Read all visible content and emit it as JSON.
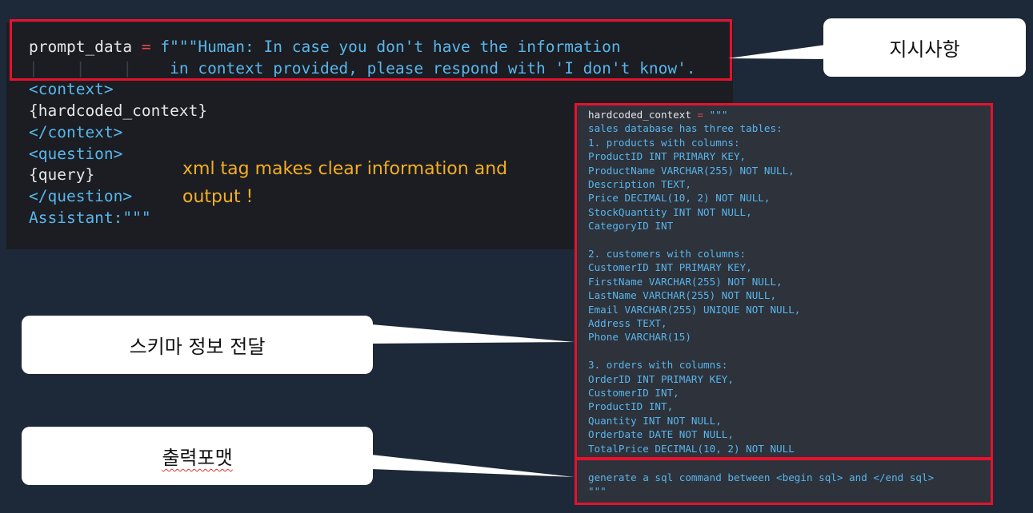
{
  "prompt_code": {
    "line1_var": "prompt_data",
    "line1_op": " = ",
    "line1_str": "f\"\"\"Human: In case you don't have the information",
    "line2_str": "in context provided, please respond with 'I don't know'.",
    "line3": "<context>",
    "line4": "{hardcoded_context}",
    "line5": "</context>",
    "line6": "<question>",
    "line7": "{query}",
    "line8": "</question>",
    "line9": "Assistant:\"\"\""
  },
  "annotation": {
    "line1": "xml tag makes clear information and",
    "line2": "output !"
  },
  "context_code": {
    "first_var": "hardcoded_context",
    "first_op": " = ",
    "first_str": "\"\"\"",
    "lines": [
      "sales database has three tables:",
      "1. products with columns:",
      "ProductID INT PRIMARY KEY,",
      "ProductName VARCHAR(255) NOT NULL,",
      "Description TEXT,",
      "Price DECIMAL(10, 2) NOT NULL,",
      "StockQuantity INT NOT NULL,",
      "CategoryID INT",
      "",
      "2. customers with columns:",
      "CustomerID INT PRIMARY KEY,",
      "FirstName VARCHAR(255) NOT NULL,",
      "LastName VARCHAR(255) NOT NULL,",
      "Email VARCHAR(255) UNIQUE NOT NULL,",
      "Address TEXT,",
      "Phone VARCHAR(15)",
      "",
      "3. orders with columns:",
      "OrderID INT PRIMARY KEY,",
      "CustomerID INT,",
      "ProductID INT,",
      "Quantity INT NOT NULL,",
      "OrderDate DATE NOT NULL,",
      "TotalPrice DECIMAL(10, 2) NOT NULL"
    ],
    "output_line1": "generate a sql command between <begin sql> and </end sql>",
    "output_line2": "\"\"\""
  },
  "callouts": {
    "instruction": "지시사항",
    "schema": "스키마 정보 전달",
    "output_format": "출력포맷"
  }
}
